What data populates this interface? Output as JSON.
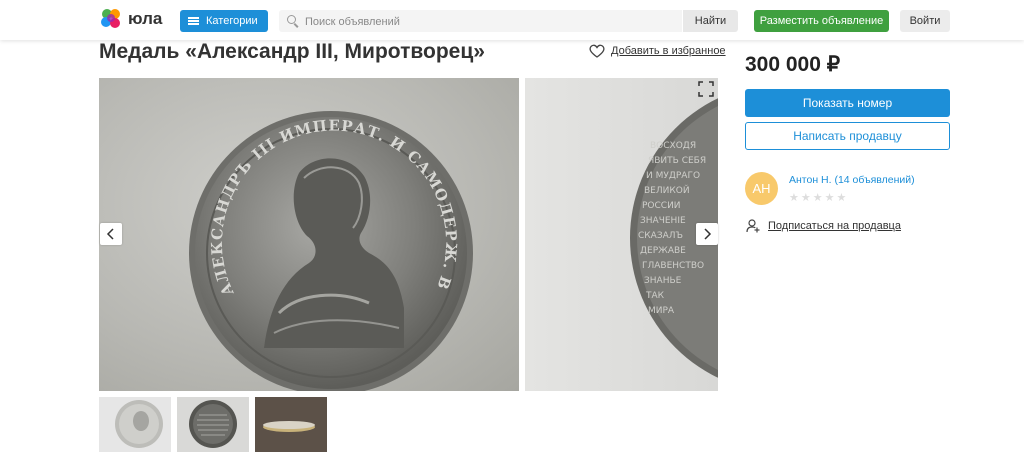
{
  "header": {
    "logo_text": "юла",
    "categories_label": "Категории",
    "search_placeholder": "Поиск объявлений",
    "find_label": "Найти",
    "post_ad_label": "Разместить объявление",
    "login_label": "Войти"
  },
  "listing": {
    "title": "Медаль «Александр III, Миротворец»",
    "favorite_label": "Добавить в избранное",
    "coin_inscription": "АЛЕКСАНДРЪ III ИМПЕРАТ. И САМОДЕРЖ. ВСЕРОСС.",
    "reverse_text": [
      "ВОСХОДЯ",
      "ЯВИТЬ СЕБЯ",
      "И МУДРАГО",
      "ВЕЛИКОЙ",
      "РОССИИ",
      "ЗНАЧЕНІЕ",
      "СКАЗАЛЪ",
      "ДЕРЖАВЕ",
      "ГЛАВЕНСТВО",
      "ЗНАНЬЕ",
      "ТАК",
      "МИРА"
    ]
  },
  "photos": {
    "count": 3
  },
  "sidebar": {
    "price": "300 000 ₽",
    "show_phone_label": "Показать номер",
    "write_seller_label": "Написать продавцу",
    "seller_initials": "АН",
    "seller_name": "Антон Н. (14 объявлений)",
    "subscribe_label": "Подписаться на продавца"
  },
  "colors": {
    "accent": "#1d8fd8",
    "post_button": "#3fa03f",
    "avatar": "#f8c96b"
  },
  "icons": [
    "logo-icon",
    "menu-icon",
    "search-icon",
    "heart-icon",
    "expand-icon",
    "chevron-left-icon",
    "chevron-right-icon",
    "star-icon",
    "add-user-icon"
  ]
}
